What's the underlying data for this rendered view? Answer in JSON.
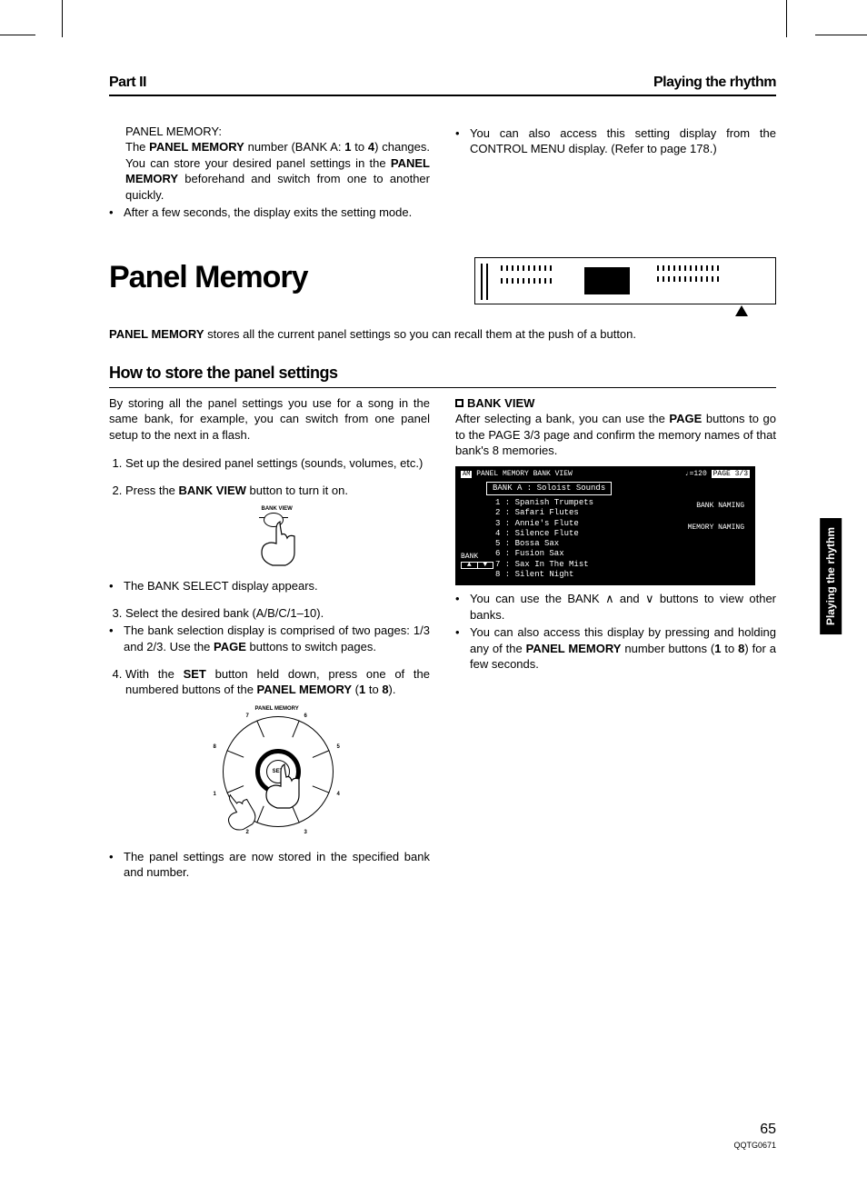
{
  "header": {
    "left": "Part II",
    "right": "Playing the rhythm"
  },
  "intro": {
    "label": "PANEL MEMORY:",
    "p1a": "The ",
    "p1b": "PANEL MEMORY",
    "p1c": " number (BANK A: ",
    "p1d": "1",
    "p1e": " to ",
    "p1f": "4",
    "p1g": ") changes. You can store your desired panel settings in the ",
    "p1h": "PANEL MEMORY",
    "p1i": " beforehand and switch from one to another quickly.",
    "b1": "After a few seconds, the display exits the setting mode.",
    "r1": "You can also access this setting display from the CONTROL MENU display. (Refer to page 178.)"
  },
  "title": "Panel Memory",
  "desc_a": "PANEL MEMORY",
  "desc_b": " stores all the current panel settings so you can recall them at the push of a button.",
  "howto_title": "How to store the panel settings",
  "howto_intro": "By storing all the panel settings you use for a song in the same bank, for example, you can switch from one panel setup to the next in a flash.",
  "steps": {
    "s1": "Set up the desired panel settings (sounds, volumes, etc.)",
    "s2a": "Press the ",
    "s2b": "BANK VIEW",
    "s2c": " button to turn it on.",
    "s2_fig_label": "BANK VIEW",
    "s2_note": "The BANK SELECT display appears.",
    "s3": "Select the desired bank (A/B/C/1–10).",
    "s3_b1a": "The bank selection display is comprised of two pages: 1/3 and 2/3. Use the ",
    "s3_b1b": "PAGE",
    "s3_b1c": " buttons to switch pages.",
    "s4a": "With the ",
    "s4b": "SET",
    "s4c": " button held down, press one of the numbered buttons of the ",
    "s4d": "PANEL MEMORY",
    "s4e": " (",
    "s4f": "1",
    "s4g": " to ",
    "s4h": "8",
    "s4i": ").",
    "s4_diag_title": "PANEL MEMORY",
    "s4_set": "SET",
    "s4_b1": "The panel settings are now stored in the specified bank and number."
  },
  "right": {
    "bv_title": "BANK VIEW",
    "bv_p1a": "After selecting a bank, you can use the ",
    "bv_p1b": "PAGE",
    "bv_p1c": " buttons to go to the PAGE 3/3 page and confirm the memory names of that bank's 8 memories.",
    "screen": {
      "header": "PANEL MEMORY BANK VIEW",
      "tempo": "♩=120",
      "page": "PAGE 3/3",
      "bank_title": "BANK  A :   Soloist Sounds",
      "bank_label": "BANK",
      "btn1": "BANK NAMING",
      "btn2": "MEMORY NAMING",
      "items": [
        "1 : Spanish Trumpets",
        "2 :  Safari Flutes",
        "3 :  Annie's Flute",
        "4 :  Silence Flute",
        "5 :    Bossa Sax",
        "6 :   Fusion Sax",
        "7 : Sax In The Mist",
        "8 :   Silent Night"
      ]
    },
    "b1": "You can use the BANK ∧ and ∨ buttons to view other banks.",
    "b2a": "You can also access this display by pressing and holding any of the ",
    "b2b": "PANEL MEMORY",
    "b2c": " number buttons (",
    "b2d": "1",
    "b2e": " to ",
    "b2f": "8",
    "b2g": ") for a few seconds."
  },
  "side_tab": "Playing the rhythm",
  "footer": {
    "page": "65",
    "code": "QQTG0671"
  },
  "dial_nums": [
    "1",
    "2",
    "3",
    "4",
    "5",
    "6",
    "7",
    "8"
  ]
}
